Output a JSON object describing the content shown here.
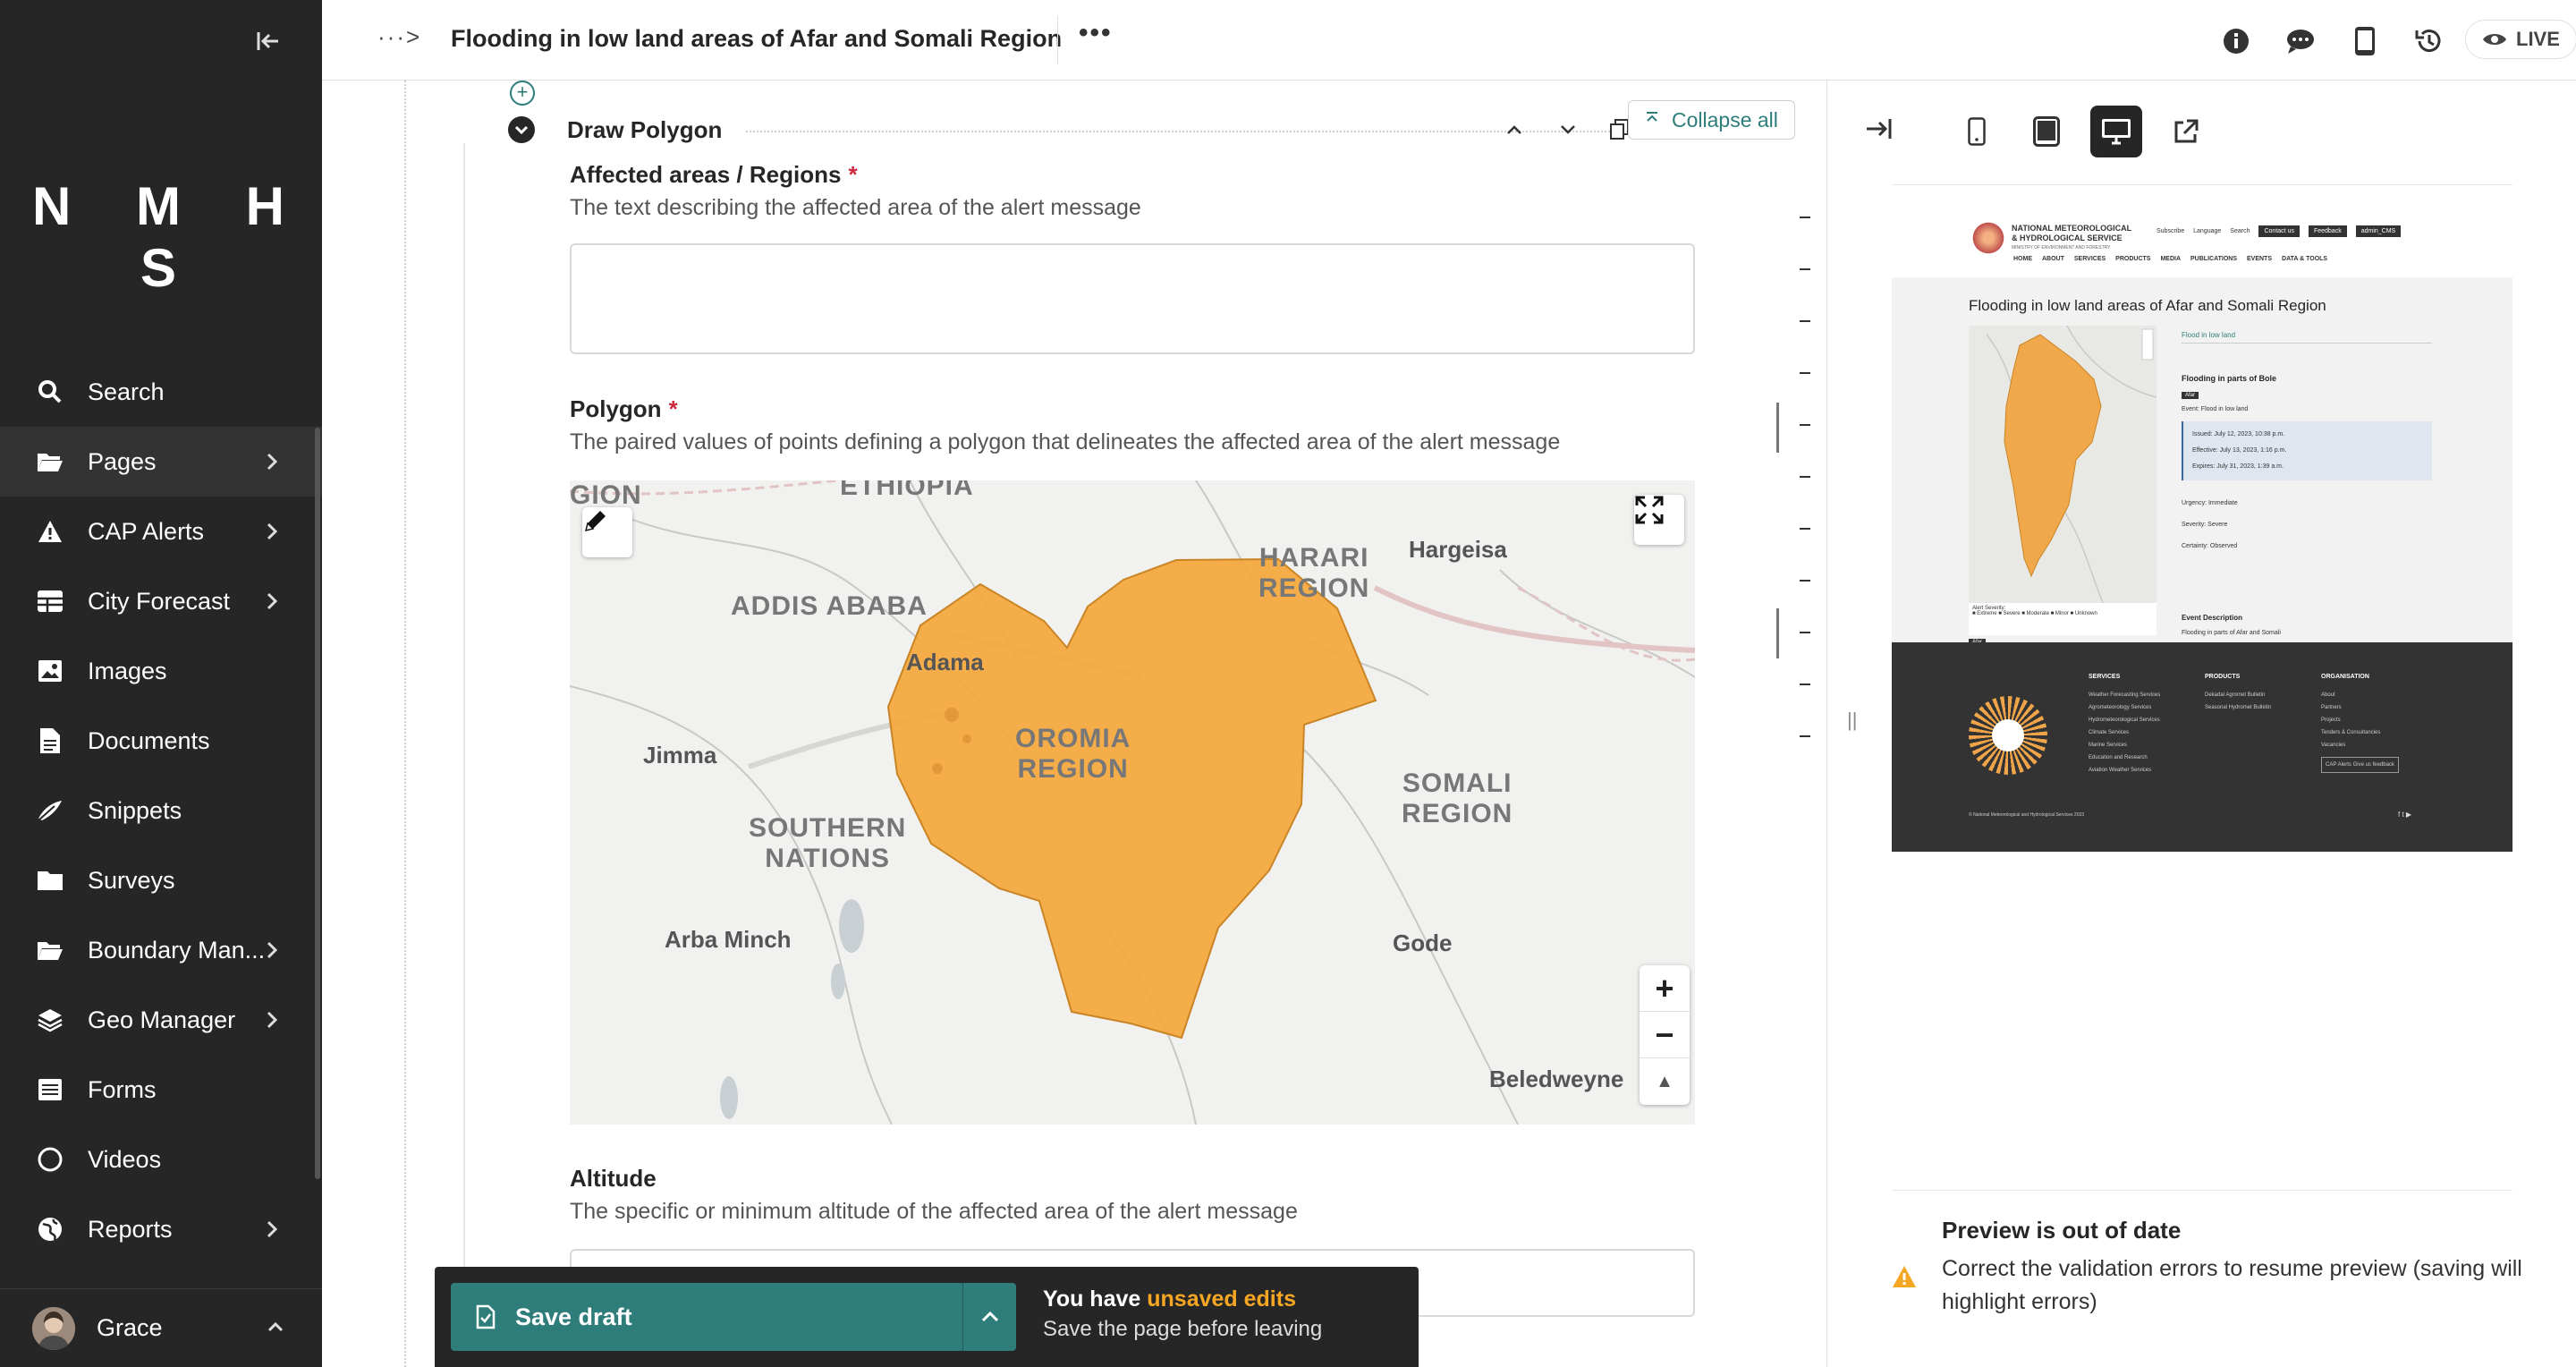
{
  "app": {
    "brand": "N M H S",
    "colors": {
      "sidebar_bg": "#262626",
      "accent": "#2e7d7a",
      "polygon": "#f5a73c",
      "warning": "#f5a623",
      "required": "#cd2a3f"
    }
  },
  "sidebar": {
    "items": [
      {
        "label": "Search",
        "icon": "search-icon",
        "has_children": false
      },
      {
        "label": "Pages",
        "icon": "folder-open-icon",
        "has_children": true,
        "active": true
      },
      {
        "label": "CAP Alerts",
        "icon": "warning-icon",
        "has_children": true
      },
      {
        "label": "City Forecast",
        "icon": "table-icon",
        "has_children": true
      },
      {
        "label": "Images",
        "icon": "image-icon",
        "has_children": false
      },
      {
        "label": "Documents",
        "icon": "document-icon",
        "has_children": false
      },
      {
        "label": "Snippets",
        "icon": "snippet-icon",
        "has_children": false
      },
      {
        "label": "Surveys",
        "icon": "folder-icon",
        "has_children": false
      },
      {
        "label": "Boundary Man...",
        "icon": "folder-open-icon",
        "has_children": true
      },
      {
        "label": "Geo Manager",
        "icon": "layers-icon",
        "has_children": true
      },
      {
        "label": "Forms",
        "icon": "list-icon",
        "has_children": false
      },
      {
        "label": "Videos",
        "icon": "circle-icon",
        "has_children": false
      },
      {
        "label": "Reports",
        "icon": "globe-icon",
        "has_children": true
      }
    ],
    "account": {
      "name": "Grace"
    }
  },
  "header": {
    "breadcrumb": "···>",
    "title": "Flooding in low land areas of Afar and Somali Region",
    "more": "•••",
    "live_label": "LIVE"
  },
  "editor": {
    "block_title": "Draw Polygon",
    "collapse_all": "Collapse all",
    "fields": {
      "areas_label": "Affected areas / Regions",
      "areas_help": "The text describing the affected area of the alert message",
      "areas_value": "",
      "polygon_label": "Polygon",
      "polygon_help": "The paired values of points defining a polygon that delineates the affected area of the alert message",
      "altitude_label": "Altitude",
      "altitude_help": "The specific or minimum altitude of the affected area of the alert message",
      "required_mark": "*"
    },
    "map": {
      "regions": [
        "GION",
        "ETHIOPIA",
        "ADDIS ABABA",
        "HARARI\nREGION",
        "OROMIA\nREGION",
        "SOMALI\nREGION",
        "SOUTHERN\nNATIONS"
      ],
      "cities": [
        "Hargeisa",
        "Adama",
        "Jimma",
        "Arba Minch",
        "Gode",
        "Beledweyne"
      ],
      "zoom_in": "+",
      "zoom_out": "−",
      "compass": "▲"
    }
  },
  "savebar": {
    "save_label": "Save draft",
    "msg_prefix": "You have",
    "msg_highlight": "unsaved edits",
    "msg_sub": "Save the page before leaving"
  },
  "preview": {
    "out_of_date_title": "Preview is out of date",
    "out_of_date_text": "Correct the validation errors to resume preview (saving will highlight errors)",
    "site": {
      "org_name": "NATIONAL METEOROLOGICAL\n& HYDROLOGICAL SERVICE",
      "org_sub": "MINISTRY OF ENVIRONMENT AND FORESTRY",
      "top_links": [
        "Subscribe",
        "Language",
        "Search"
      ],
      "top_buttons": [
        "Contact us",
        "Feedback",
        "admin_CMS"
      ],
      "menu": [
        "HOME",
        "ABOUT",
        "SERVICES",
        "PRODUCTS",
        "MEDIA",
        "PUBLICATIONS",
        "EVENTS",
        "DATA & TOOLS"
      ],
      "page_title": "Flooding in low land areas of Afar and Somali Region",
      "tab": "Flood in low land",
      "card_title": "Flooding in parts of Bole",
      "tag": "Afar",
      "event": "Event:   Flood in low land",
      "times": [
        "Issued: July 12, 2023, 10:38 p.m.",
        "Effective: July 13, 2023, 1:16 p.m.",
        "Expires: July 31, 2023, 1:39 a.m."
      ],
      "urgency": "Urgency: Immediate",
      "severity": "Severity: Severe",
      "certainty": "Certainty: Observed",
      "desc_title": "Event Description",
      "desc": "Flooding in parts of Afar and Somali",
      "legend_title": "Alert Severity:",
      "legend_items": "■ Extreme  ■ Severe  ■ Moderate  ■ Minor  ■ Unknown",
      "map_pill": "Afar",
      "footer_cols": [
        {
          "title": "SERVICES",
          "items": [
            "Weather Forecasting Services",
            "Agrometeorology Services",
            "Hydrometeorological Services",
            "Climate Services",
            "Marine Services",
            "Education and Research",
            "Aviation Weather Services"
          ]
        },
        {
          "title": "PRODUCTS",
          "items": [
            "Dekadal Agromet Bulletin",
            "Seasonal Hydromet Bulletin"
          ]
        },
        {
          "title": "ORGANISATION",
          "items": [
            "About",
            "Partners",
            "Projects",
            "Tenders & Consultancies",
            "Vacancies"
          ]
        }
      ],
      "footer_buttons": "CAP Alerts   Give us feedback",
      "copyright": "© National Meteorological and Hydrological Services 2023",
      "social": "f  t  ▶"
    }
  }
}
